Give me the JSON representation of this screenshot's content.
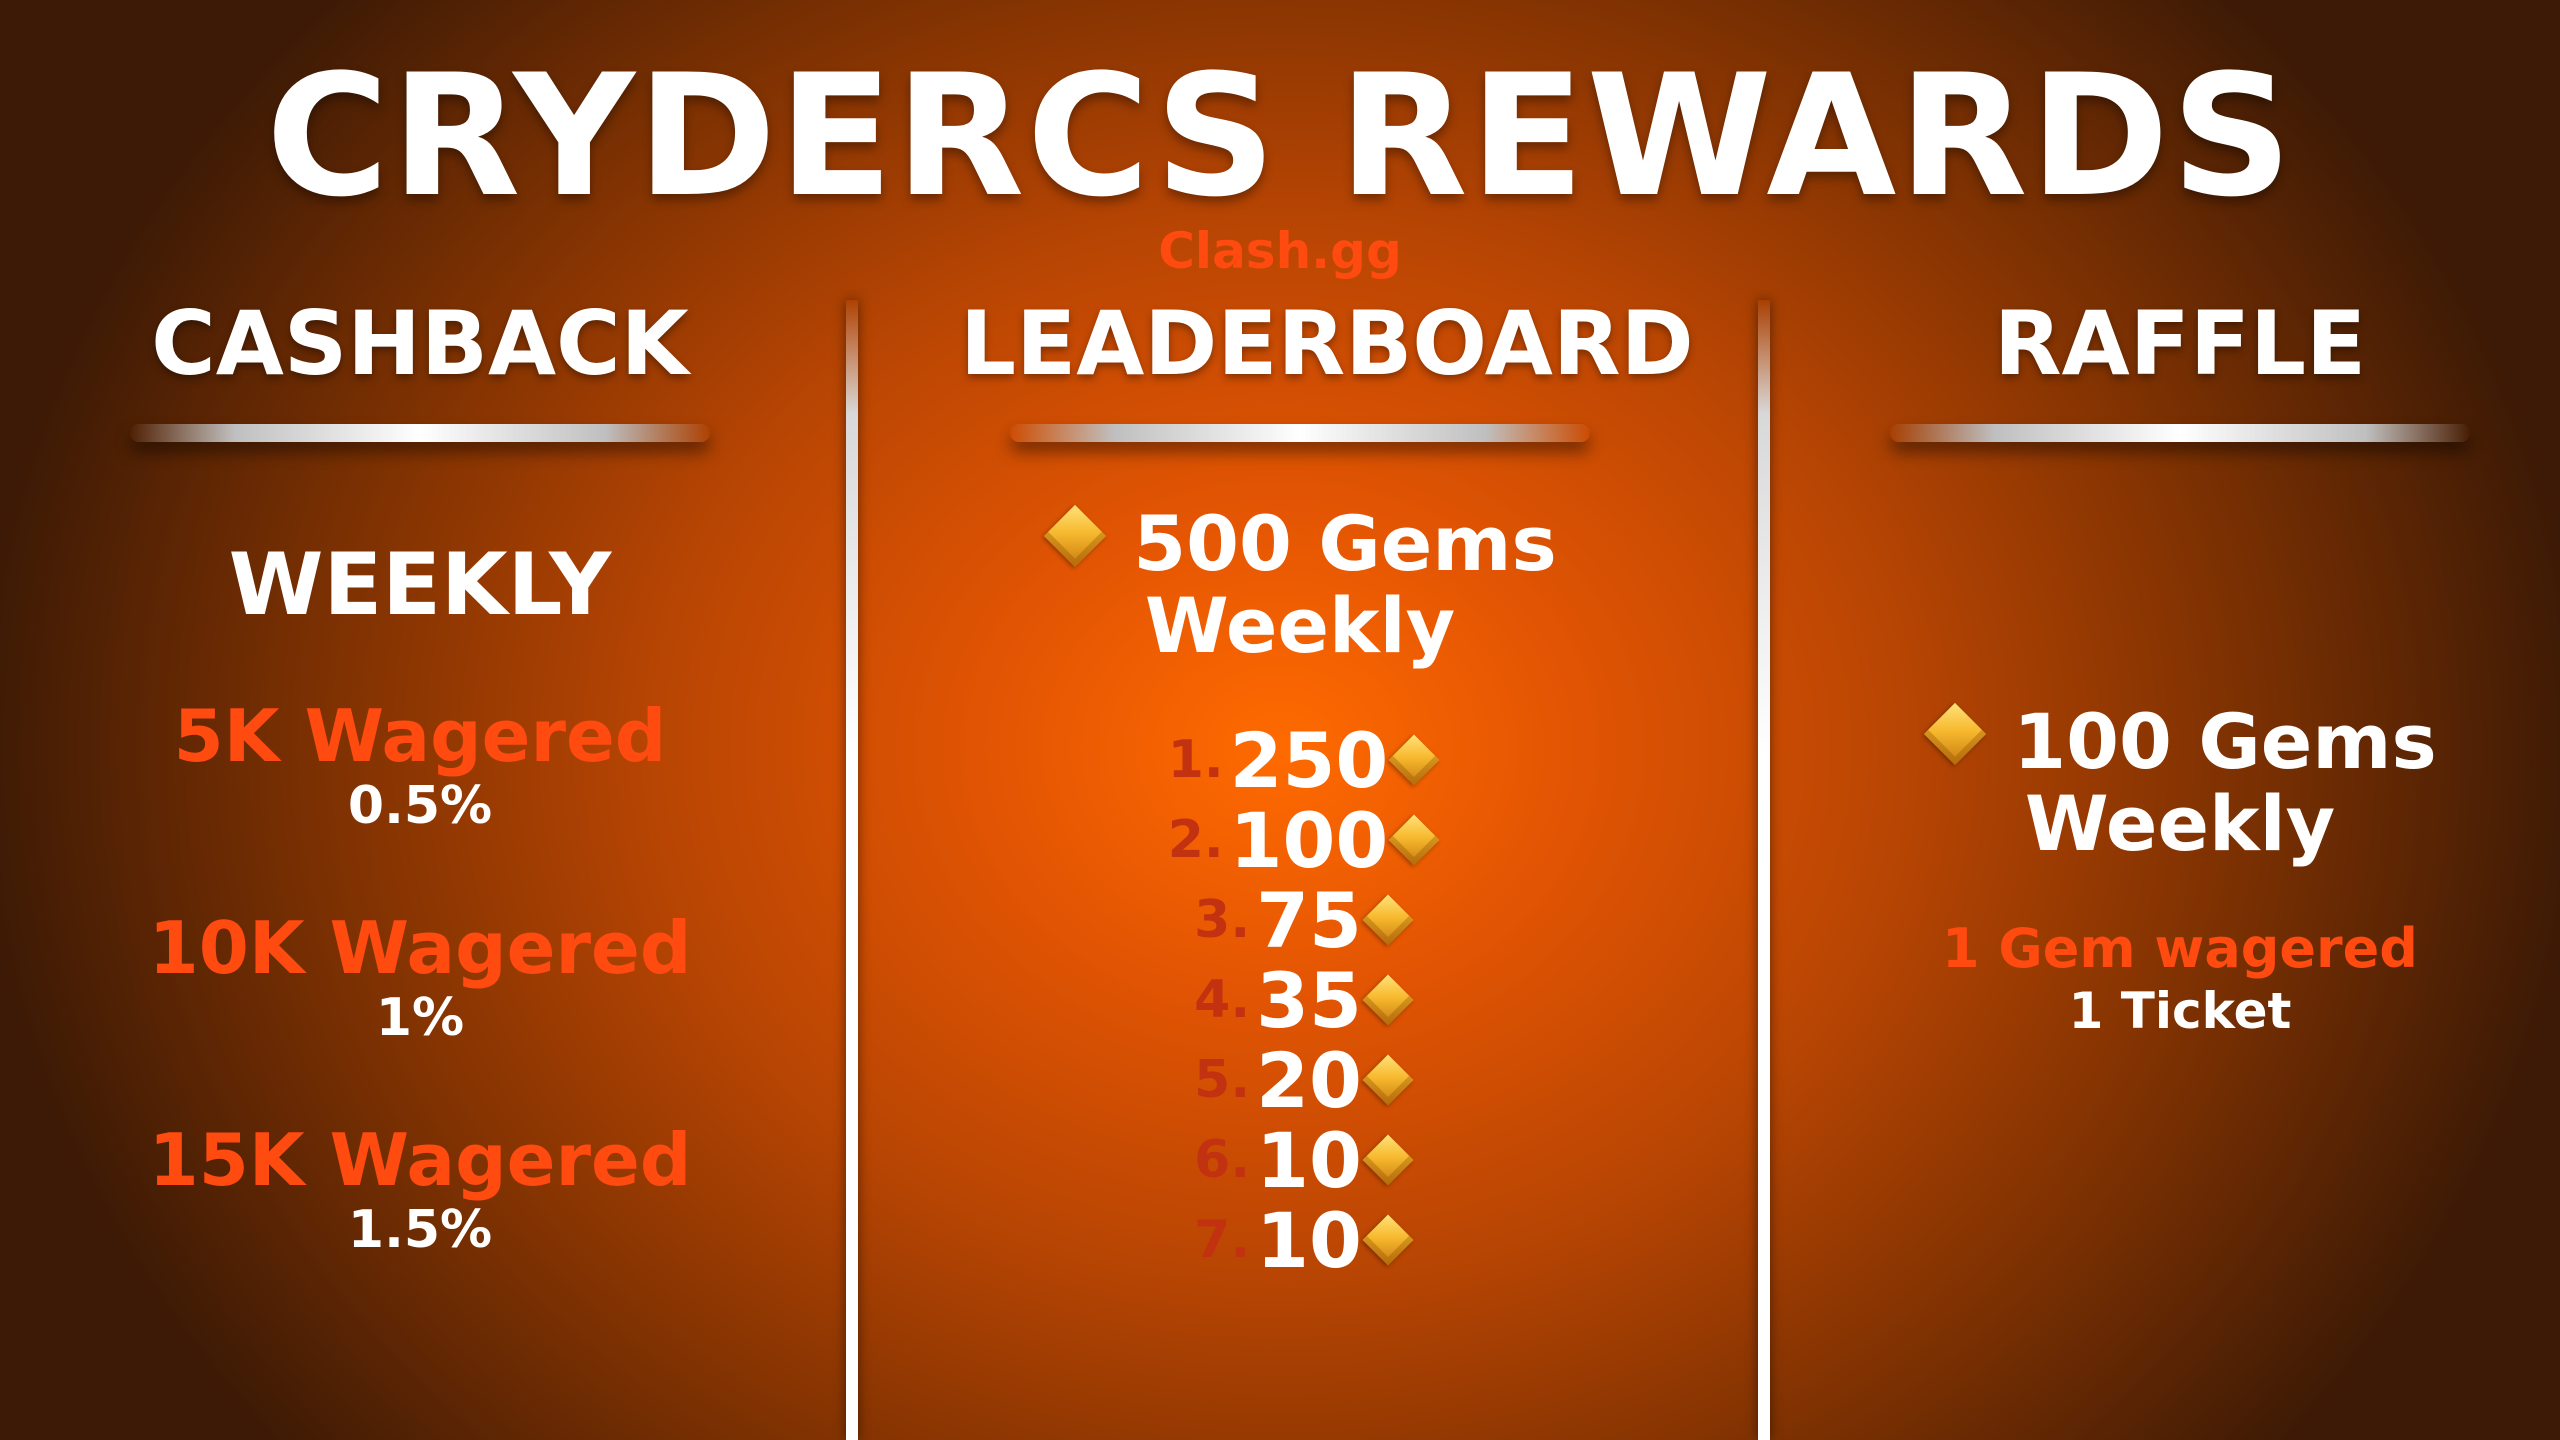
{
  "header": {
    "title": "CRYDERCS REWARDS",
    "subtitle": "Clash.gg"
  },
  "cashback": {
    "heading": "CASHBACK",
    "period": "WEEKLY",
    "tiers": [
      {
        "label": "5K Wagered",
        "value": "0.5%"
      },
      {
        "label": "10K Wagered",
        "value": "1%"
      },
      {
        "label": "15K Wagered",
        "value": "1.5%"
      }
    ]
  },
  "leaderboard": {
    "heading": "LEADERBOARD",
    "prize": "500 Gems",
    "period": "Weekly",
    "ranks": [
      {
        "rank": "1.",
        "value": "250"
      },
      {
        "rank": "2.",
        "value": "100"
      },
      {
        "rank": "3.",
        "value": "75"
      },
      {
        "rank": "4.",
        "value": "35"
      },
      {
        "rank": "5.",
        "value": "20"
      },
      {
        "rank": "6.",
        "value": "10"
      },
      {
        "rank": "7.",
        "value": "10"
      }
    ]
  },
  "raffle": {
    "heading": "RAFFLE",
    "prize": "100 Gems",
    "period": "Weekly",
    "rule_label": "1 Gem wagered",
    "rule_value": "1 Ticket"
  },
  "colors": {
    "accent": "#ff4a10",
    "rank": "#c23210",
    "gem": "#f7b92e"
  },
  "icons": {
    "gem": "gem-icon"
  }
}
